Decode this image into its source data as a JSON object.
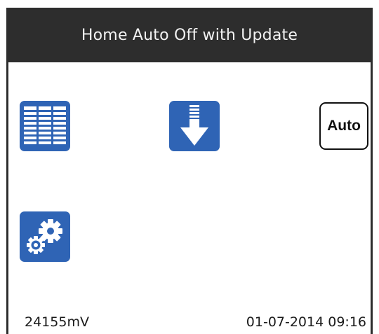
{
  "title": "Home Auto Off with Update",
  "icons": {
    "list": "list-icon",
    "download": "download-icon",
    "settings": "gears-icon"
  },
  "auto_button": {
    "label": "Auto"
  },
  "status": {
    "voltage": "24155mV",
    "datetime": "01-07-2014 09:16"
  },
  "colors": {
    "tile_blue": "#2f64b5",
    "title_bar": "#2d2d2d",
    "screen": "#ffffff"
  }
}
